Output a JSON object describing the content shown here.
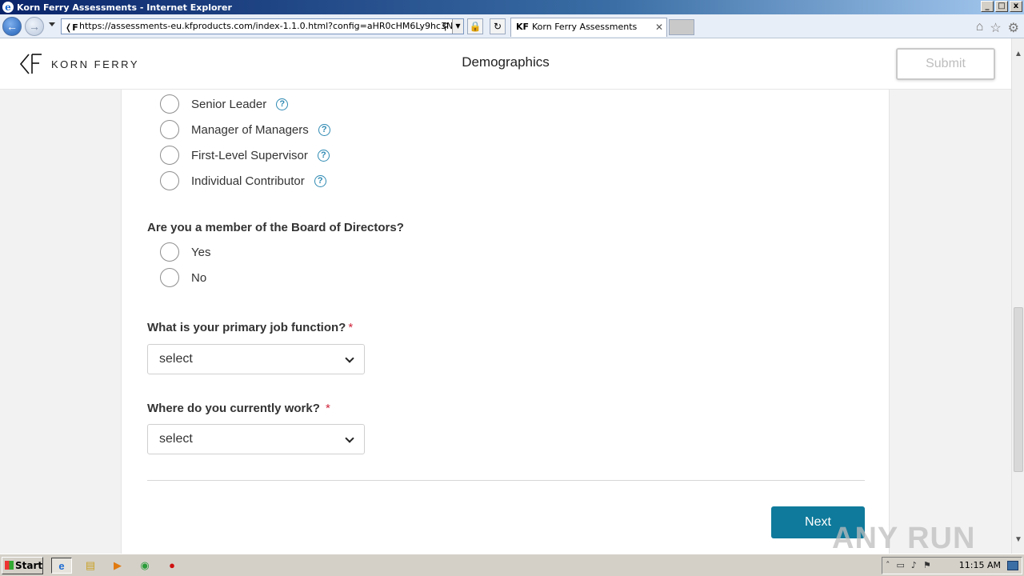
{
  "window": {
    "title": "Korn Ferry Assessments - Internet Explorer",
    "controls": [
      "_",
      "□",
      "x"
    ]
  },
  "browser": {
    "url": "https://assessments-eu.kfproducts.com/index-1.1.0.html?config=aHR0cHM6Ly9hc3Nlc3NtZW50cy1ldS5rZnByb2R1Y3RzLmNvbQ",
    "tab_title": "Korn Ferry Assessments",
    "tab_favicon": "KF"
  },
  "header": {
    "logo_text": "KORN FERRY",
    "page_title": "Demographics",
    "submit_label": "Submit"
  },
  "level_options": [
    {
      "label": "Senior Leader"
    },
    {
      "label": "Manager of Managers"
    },
    {
      "label": "First-Level Supervisor"
    },
    {
      "label": "Individual Contributor"
    }
  ],
  "board_question": {
    "text": "Are you a member of the Board of Directors?",
    "options": [
      {
        "label": "Yes"
      },
      {
        "label": "No"
      }
    ]
  },
  "job_function": {
    "text": "What is your primary job function?",
    "required_mark": "*",
    "value": "select"
  },
  "work_location": {
    "text": "Where do you currently work?",
    "required_mark": "*",
    "value": "select"
  },
  "next_label": "Next",
  "watermark": "ANY RUN",
  "taskbar": {
    "start_label": "Start",
    "clock": "11:15 AM"
  },
  "colors": {
    "accent": "#0f7a9b",
    "help_icon": "#2f8ab3",
    "required": "#d0243a"
  }
}
